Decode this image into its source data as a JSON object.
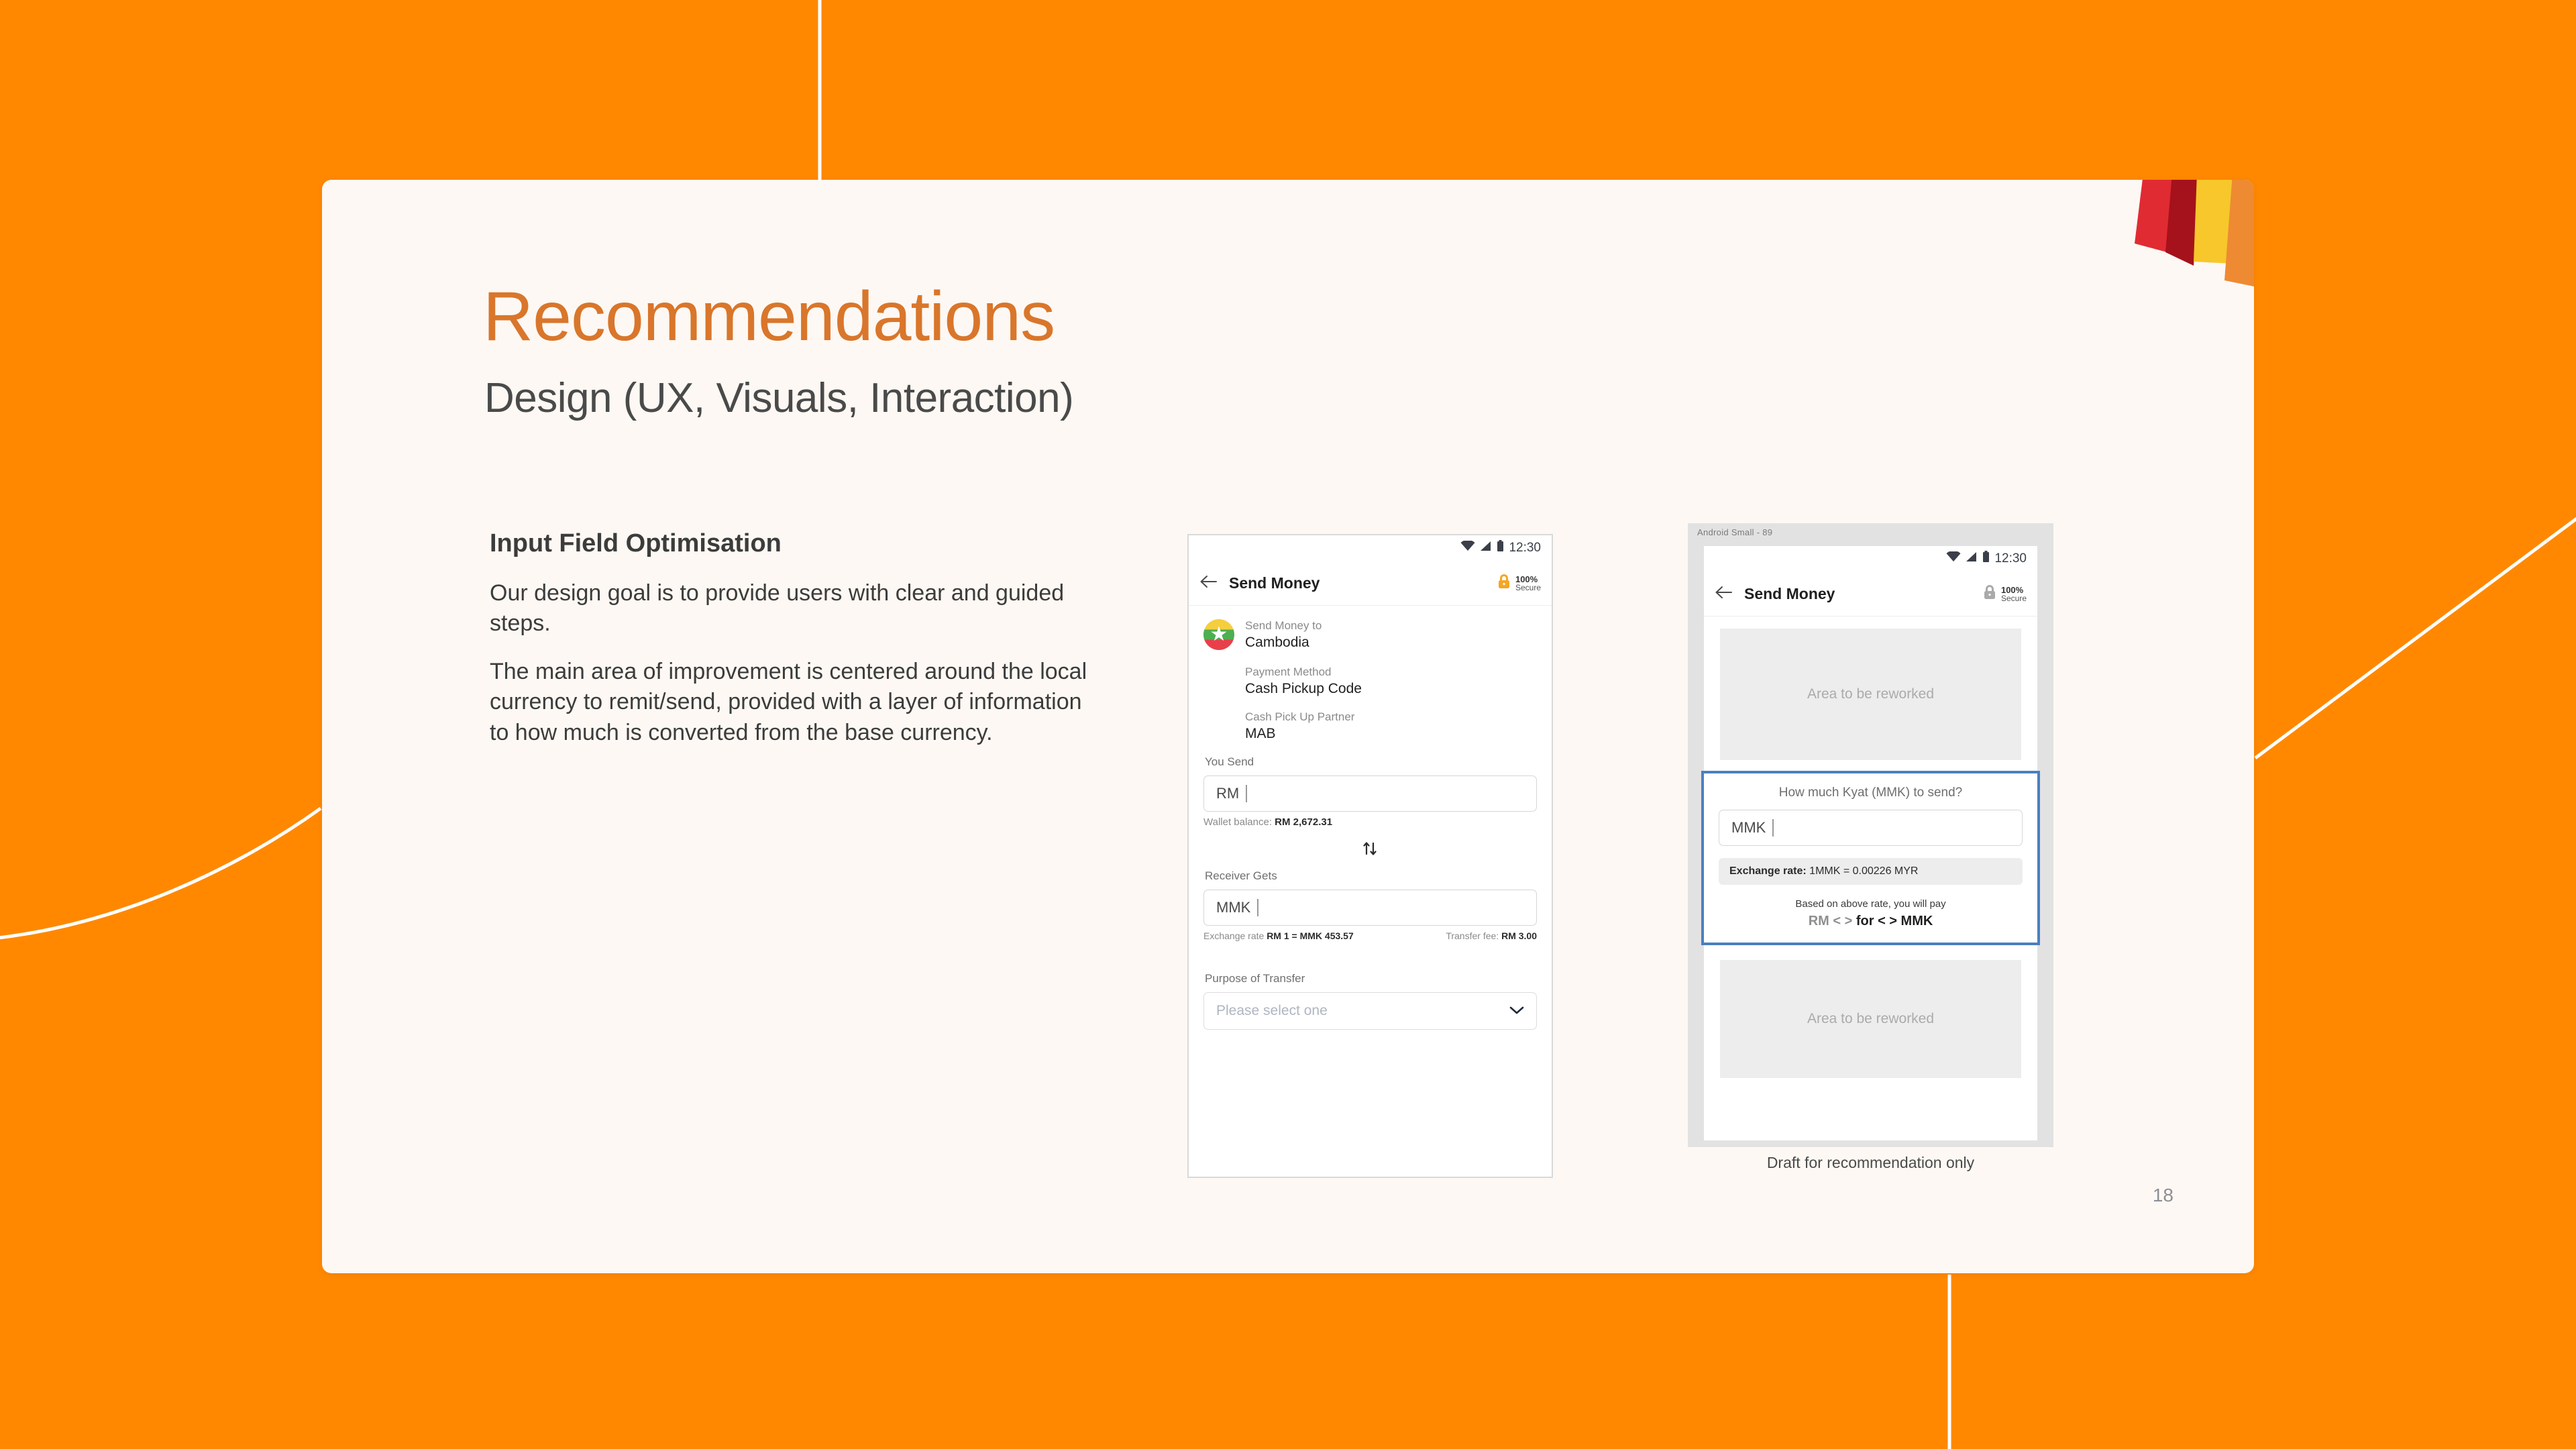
{
  "slide": {
    "title": "Recommendations",
    "subtitle": "Design (UX, Visuals, Interaction)",
    "page_number": "18",
    "accent_color": "#D9762B",
    "background_color": "#FF8800",
    "card_color": "#FDF8F3"
  },
  "copy": {
    "heading": "Input Field Optimisation",
    "paragraph_1": "Our design goal is to provide users with clear and guided steps.",
    "paragraph_2": "The main area of improvement is centered around the local currency to remit/send, provided with a layer of information to how much is converted from the base currency."
  },
  "phone_before": {
    "status_bar": {
      "time": "12:30",
      "wifi_icon": "wifi-icon",
      "signal_icon": "signal-icon",
      "battery_icon": "battery-icon"
    },
    "app_bar": {
      "back_icon": "back-arrow-icon",
      "title": "Send Money",
      "lock_icon": "lock-icon",
      "secure_percent": "100%",
      "secure_label": "Secure"
    },
    "destination": {
      "flag_icon": "myanmar-flag-icon",
      "label": "Send Money to",
      "value": "Cambodia"
    },
    "payment_method": {
      "label": "Payment Method",
      "value": "Cash Pickup Code"
    },
    "pickup_partner": {
      "label": "Cash Pick Up Partner",
      "value": "MAB"
    },
    "you_send": {
      "label": "You Send",
      "currency": "RM",
      "value": "",
      "wallet_label": "Wallet balance:",
      "wallet_value": "RM 2,672.31"
    },
    "swap_icon": "swap-vertical-icon",
    "receiver_gets": {
      "label": "Receiver Gets",
      "currency": "MMK",
      "value": "",
      "rate_label": "Exchange rate",
      "rate_value": "RM 1 = MMK 453.57",
      "fee_label": "Transfer fee:",
      "fee_value": "RM 3.00"
    },
    "purpose": {
      "label": "Purpose of Transfer",
      "placeholder": "Please select one",
      "chevron_icon": "chevron-down-icon"
    }
  },
  "phone_after": {
    "frame_label": "Android Small - 89",
    "status_bar": {
      "time": "12:30",
      "wifi_icon": "wifi-icon",
      "signal_icon": "signal-icon",
      "battery_icon": "battery-icon"
    },
    "app_bar": {
      "back_icon": "back-arrow-icon",
      "title": "Send Money",
      "lock_icon": "lock-icon",
      "secure_percent": "100%",
      "secure_label": "Secure"
    },
    "rework_top": "Area to be reworked",
    "highlight": {
      "border_color": "#4A7FC1",
      "question": "How much Kyat (MMK) to send?",
      "currency": "MMK",
      "value": "",
      "rate_label": "Exchange rate:",
      "rate_value": "1MMK = 0.00226 MYR",
      "pay_note": "Based on above rate, you will pay",
      "pay_prefix": "RM < >",
      "pay_middle": "for",
      "pay_suffix": "< > MMK"
    },
    "rework_bottom": "Area to be reworked",
    "caption": "Draft for recommendation only"
  },
  "transition": {
    "arrow_icon": "arrow-right-circle-icon",
    "color": "#4A7FC1"
  }
}
